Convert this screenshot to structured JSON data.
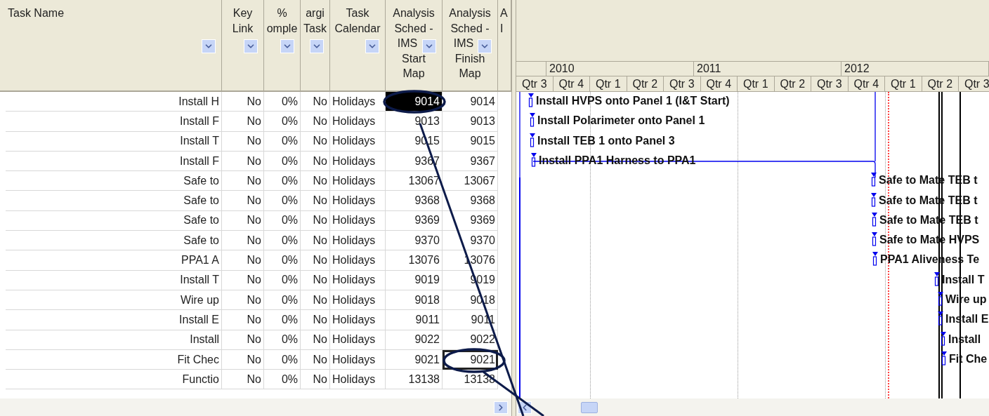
{
  "table": {
    "columns": [
      {
        "lines": [
          "Task Name"
        ]
      },
      {
        "lines": [
          "Key",
          "Link"
        ]
      },
      {
        "lines": [
          "%",
          "omple"
        ]
      },
      {
        "lines": [
          "argi",
          "Task"
        ]
      },
      {
        "lines": [
          "Task",
          "Calendar"
        ]
      },
      {
        "lines": [
          "Analysis",
          "Sched -",
          "IMS",
          "Start",
          "Map"
        ]
      },
      {
        "lines": [
          "Analysis",
          "Sched -",
          "IMS",
          "Finish",
          "Map"
        ]
      },
      {
        "lines": [
          "A",
          "I"
        ]
      }
    ],
    "rows": [
      {
        "name": "Install H",
        "key_link": "No",
        "complete": "0%",
        "marginal": "No",
        "calendar": "Holidays",
        "start": "9014",
        "finish": "9014",
        "start_selected": true,
        "finish_focused": false
      },
      {
        "name": "Install F",
        "key_link": "No",
        "complete": "0%",
        "marginal": "No",
        "calendar": "Holidays",
        "start": "9013",
        "finish": "9013",
        "start_selected": false,
        "finish_focused": false
      },
      {
        "name": "Install T",
        "key_link": "No",
        "complete": "0%",
        "marginal": "No",
        "calendar": "Holidays",
        "start": "9015",
        "finish": "9015",
        "start_selected": false,
        "finish_focused": false
      },
      {
        "name": "Install F",
        "key_link": "No",
        "complete": "0%",
        "marginal": "No",
        "calendar": "Holidays",
        "start": "9367",
        "finish": "9367",
        "start_selected": false,
        "finish_focused": false
      },
      {
        "name": "Safe to",
        "key_link": "No",
        "complete": "0%",
        "marginal": "No",
        "calendar": "Holidays",
        "start": "13067",
        "finish": "13067",
        "start_selected": false,
        "finish_focused": false
      },
      {
        "name": "Safe to",
        "key_link": "No",
        "complete": "0%",
        "marginal": "No",
        "calendar": "Holidays",
        "start": "9368",
        "finish": "9368",
        "start_selected": false,
        "finish_focused": false
      },
      {
        "name": "Safe to",
        "key_link": "No",
        "complete": "0%",
        "marginal": "No",
        "calendar": "Holidays",
        "start": "9369",
        "finish": "9369",
        "start_selected": false,
        "finish_focused": false
      },
      {
        "name": "Safe to",
        "key_link": "No",
        "complete": "0%",
        "marginal": "No",
        "calendar": "Holidays",
        "start": "9370",
        "finish": "9370",
        "start_selected": false,
        "finish_focused": false
      },
      {
        "name": "PPA1 A",
        "key_link": "No",
        "complete": "0%",
        "marginal": "No",
        "calendar": "Holidays",
        "start": "13076",
        "finish": "13076",
        "start_selected": false,
        "finish_focused": false
      },
      {
        "name": "Install T",
        "key_link": "No",
        "complete": "0%",
        "marginal": "No",
        "calendar": "Holidays",
        "start": "9019",
        "finish": "9019",
        "start_selected": false,
        "finish_focused": false
      },
      {
        "name": "Wire up",
        "key_link": "No",
        "complete": "0%",
        "marginal": "No",
        "calendar": "Holidays",
        "start": "9018",
        "finish": "9018",
        "start_selected": false,
        "finish_focused": false
      },
      {
        "name": "Install E",
        "key_link": "No",
        "complete": "0%",
        "marginal": "No",
        "calendar": "Holidays",
        "start": "9011",
        "finish": "9011",
        "start_selected": false,
        "finish_focused": false
      },
      {
        "name": "Install",
        "key_link": "No",
        "complete": "0%",
        "marginal": "No",
        "calendar": "Holidays",
        "start": "9022",
        "finish": "9022",
        "start_selected": false,
        "finish_focused": false
      },
      {
        "name": "Fit Chec",
        "key_link": "No",
        "complete": "0%",
        "marginal": "No",
        "calendar": "Holidays",
        "start": "9021",
        "finish": "9021",
        "start_selected": false,
        "finish_focused": true
      },
      {
        "name": "Functio",
        "key_link": "No",
        "complete": "0%",
        "marginal": "No",
        "calendar": "Holidays",
        "start": "13138",
        "finish": "13138",
        "start_selected": false,
        "finish_focused": false
      }
    ]
  },
  "gantt": {
    "years": [
      "2010",
      "2011",
      "2012"
    ],
    "quarters": [
      "Qtr 3",
      "Qtr 4",
      "Qtr 1",
      "Qtr 2",
      "Qtr 3",
      "Qtr 4",
      "Qtr 1",
      "Qtr 2",
      "Qtr 3",
      "Qtr 4",
      "Qtr 1",
      "Qtr 2",
      "Qtr 3"
    ],
    "tasks": [
      {
        "label": "Install HVPS onto Panel 1 (I&T Start)"
      },
      {
        "label": "Install Polarimeter onto Panel 1"
      },
      {
        "label": "Install TEB 1 onto Panel 3"
      },
      {
        "label": "Install PPA1 Harness to PPA1"
      },
      {
        "label": "Safe to Mate TEB t"
      },
      {
        "label": "Safe to Mate TEB t"
      },
      {
        "label": "Safe to Mate TEB t"
      },
      {
        "label": "Safe to Mate HVPS"
      },
      {
        "label": "PPA1 Aliveness Te"
      },
      {
        "label": "Install T"
      },
      {
        "label": "Wire up"
      },
      {
        "label": "Install E"
      },
      {
        "label": "Install"
      },
      {
        "label": "Fit Che"
      }
    ]
  }
}
